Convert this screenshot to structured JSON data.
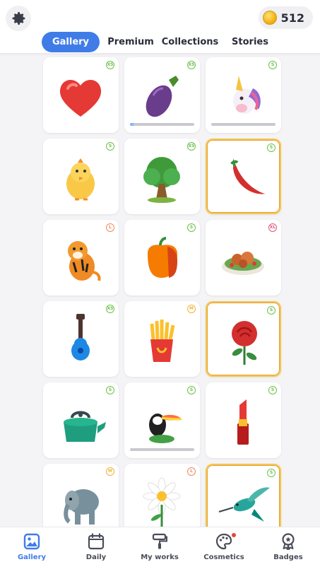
{
  "header": {
    "coins": "512",
    "tabs": [
      {
        "label": "Gallery",
        "active": true
      },
      {
        "label": "Premium",
        "active": false
      },
      {
        "label": "Collections",
        "active": false
      },
      {
        "label": "Stories",
        "active": false
      }
    ]
  },
  "gallery": {
    "items": [
      {
        "name": "heart",
        "size": "XS",
        "special": false,
        "progress": null
      },
      {
        "name": "eggplant",
        "size": "XS",
        "special": false,
        "progress": 0.05
      },
      {
        "name": "unicorn",
        "size": "S",
        "special": false,
        "progress": 0
      },
      {
        "name": "chick",
        "size": "S",
        "special": false,
        "progress": null
      },
      {
        "name": "tree",
        "size": "XS",
        "special": false,
        "progress": null
      },
      {
        "name": "chili-pepper",
        "size": "S",
        "special": true,
        "progress": null
      },
      {
        "name": "tiger",
        "size": "L",
        "special": false,
        "progress": null
      },
      {
        "name": "bell-pepper",
        "size": "S",
        "special": false,
        "progress": null
      },
      {
        "name": "salad-plate",
        "size": "XL",
        "special": false,
        "progress": null
      },
      {
        "name": "guitar",
        "size": "XS",
        "special": false,
        "progress": null
      },
      {
        "name": "fries",
        "size": "M",
        "special": false,
        "progress": null
      },
      {
        "name": "rose",
        "size": "S",
        "special": true,
        "progress": null
      },
      {
        "name": "kettle",
        "size": "S",
        "special": false,
        "progress": null
      },
      {
        "name": "toucan",
        "size": "S",
        "special": false,
        "progress": 0
      },
      {
        "name": "lipstick",
        "size": "S",
        "special": false,
        "progress": null
      },
      {
        "name": "elephant",
        "size": "M",
        "special": false,
        "progress": null
      },
      {
        "name": "daisy",
        "size": "L",
        "special": false,
        "progress": null
      },
      {
        "name": "hummingbird",
        "size": "S",
        "special": true,
        "progress": null
      }
    ]
  },
  "nav": {
    "items": [
      {
        "label": "Gallery",
        "icon": "image-icon",
        "active": true
      },
      {
        "label": "Daily",
        "icon": "calendar-icon",
        "active": false
      },
      {
        "label": "My works",
        "icon": "paint-roller-icon",
        "active": false
      },
      {
        "label": "Cosmetics",
        "icon": "palette-icon",
        "active": false,
        "notification": true
      },
      {
        "label": "Badges",
        "icon": "badge-icon",
        "active": false
      }
    ]
  },
  "colors": {
    "accent": "#3f7ce8",
    "special_border": "#f2c94c",
    "badge_s": "#6cc24a",
    "badge_m": "#f0b43c",
    "badge_l": "#ef8a5b",
    "badge_xl": "#e05a7a"
  }
}
